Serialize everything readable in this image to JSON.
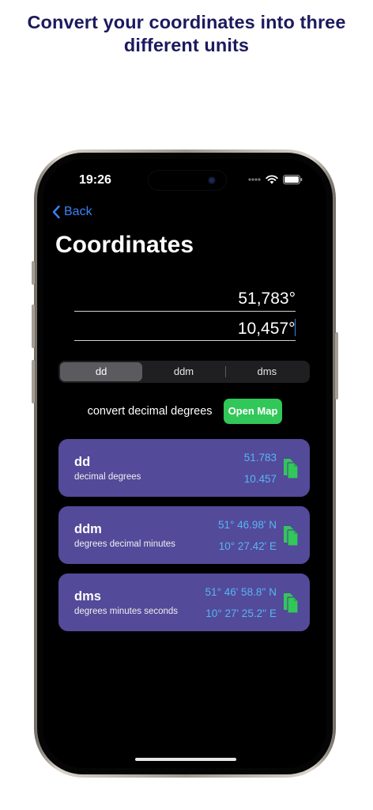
{
  "headline": {
    "line1": "Convert your coordinates into three",
    "line2": "different units"
  },
  "status_bar": {
    "time": "19:26",
    "icons": [
      "signal-dots-icon",
      "wifi-icon",
      "battery-icon"
    ]
  },
  "nav": {
    "back_label": "Back",
    "back_icon": "chevron-left-icon"
  },
  "page_title": "Coordinates",
  "inputs": {
    "latitude_value": "51,783°",
    "longitude_value": "10,457°"
  },
  "segmented_control": {
    "options": [
      "dd",
      "ddm",
      "dms"
    ],
    "selected": "dd"
  },
  "convert": {
    "label": "convert decimal degrees",
    "open_map_label": "Open Map"
  },
  "cards": [
    {
      "title": "dd",
      "subtitle": "decimal degrees",
      "value1": "51.783",
      "value2": "10.457"
    },
    {
      "title": "ddm",
      "subtitle": "degrees decimal minutes",
      "value1": "51° 46.98' N",
      "value2": "10° 27.42' E"
    },
    {
      "title": "dms",
      "subtitle": "degrees minutes seconds",
      "value1": "51° 46' 58.8'' N",
      "value2": "10° 27' 25.2'' E"
    }
  ],
  "colors": {
    "headline": "#1c1a5e",
    "accent_blue": "#3b82f6",
    "card_bg": "#534a99",
    "card_value": "#59b4f5",
    "open_map_bg": "#32c759",
    "copy_icon": "#32c759"
  }
}
